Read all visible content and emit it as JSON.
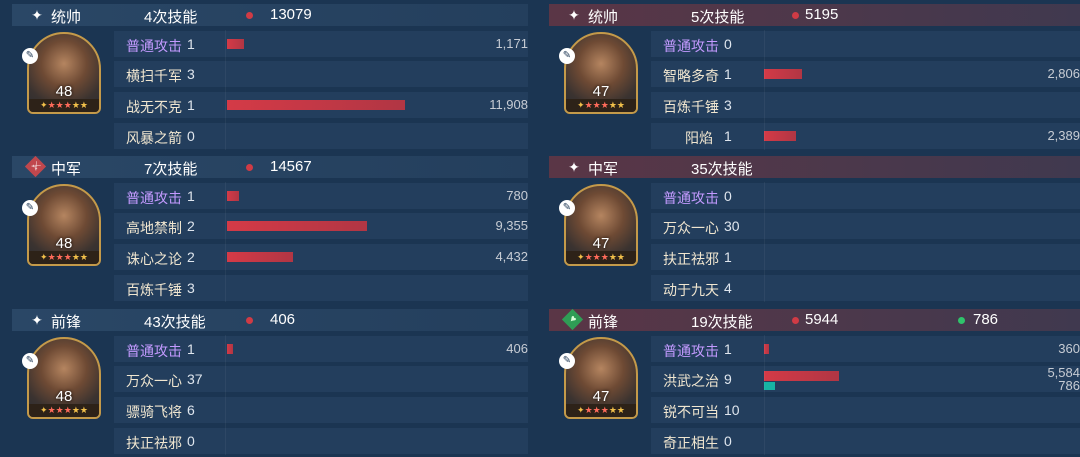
{
  "left": {
    "sections": [
      {
        "role": "统帅",
        "role_icon": "sparkle-icon",
        "skill_count": "4次技能",
        "damage": "13079",
        "level": "48",
        "rows": [
          {
            "name": "普通攻击",
            "count": "1",
            "value": "1,171",
            "bar_fraction": 0.0983,
            "normal": true
          },
          {
            "name": "横扫千军",
            "count": "3",
            "value": "",
            "bar_fraction": 0,
            "normal": false
          },
          {
            "name": "战无不克",
            "count": "1",
            "value": "11,908",
            "bar_fraction": 1.0,
            "normal": false
          },
          {
            "name": "风暴之箭",
            "count": "0",
            "value": "",
            "bar_fraction": 0,
            "normal": false
          }
        ]
      },
      {
        "role": "中军",
        "role_icon": "sword-icon",
        "skill_count": "7次技能",
        "damage": "14567",
        "level": "48",
        "rows": [
          {
            "name": "普通攻击",
            "count": "1",
            "value": "780",
            "bar_fraction": 0.0655,
            "normal": true
          },
          {
            "name": "高地禁制",
            "count": "2",
            "value": "9,355",
            "bar_fraction": 0.7856,
            "normal": false
          },
          {
            "name": "诛心之论",
            "count": "2",
            "value": "4,432",
            "bar_fraction": 0.3722,
            "normal": false
          },
          {
            "name": "百炼千锤",
            "count": "3",
            "value": "",
            "bar_fraction": 0,
            "normal": false
          }
        ]
      },
      {
        "role": "前锋",
        "role_icon": "sparkle-icon",
        "skill_count": "43次技能",
        "damage": "406",
        "level": "48",
        "rows": [
          {
            "name": "普通攻击",
            "count": "1",
            "value": "406",
            "bar_fraction": 0.0341,
            "normal": true
          },
          {
            "name": "万众一心",
            "count": "37",
            "value": "",
            "bar_fraction": 0,
            "normal": false
          },
          {
            "name": "骠骑飞将",
            "count": "6",
            "value": "",
            "bar_fraction": 0,
            "normal": false
          },
          {
            "name": "扶正祛邪",
            "count": "0",
            "value": "",
            "bar_fraction": 0,
            "normal": false
          }
        ]
      }
    ]
  },
  "right": {
    "sections": [
      {
        "role": "统帅",
        "role_icon": "sparkle-icon",
        "skill_count": "5次技能",
        "damage": "5195",
        "heal": "",
        "level": "47",
        "rows": [
          {
            "name": "普通攻击",
            "count": "0",
            "value": "",
            "bar_fraction": 0,
            "normal": true
          },
          {
            "name": "智略多奇",
            "count": "1",
            "value": "2,806",
            "bar_fraction": 0.2356,
            "normal": false
          },
          {
            "name": "百炼千锤",
            "count": "3",
            "value": "",
            "bar_fraction": 0,
            "normal": false
          },
          {
            "name": "阳焰",
            "count": "1",
            "value": "2,389",
            "bar_fraction": 0.2006,
            "normal": false
          }
        ]
      },
      {
        "role": "中军",
        "role_icon": "sparkle-icon",
        "skill_count": "35次技能",
        "damage": "",
        "heal": "",
        "level": "47",
        "rows": [
          {
            "name": "普通攻击",
            "count": "0",
            "value": "",
            "bar_fraction": 0,
            "normal": true
          },
          {
            "name": "万众一心",
            "count": "30",
            "value": "",
            "bar_fraction": 0,
            "normal": false
          },
          {
            "name": "扶正祛邪",
            "count": "1",
            "value": "",
            "bar_fraction": 0,
            "normal": false
          },
          {
            "name": "动于九天",
            "count": "4",
            "value": "",
            "bar_fraction": 0,
            "normal": false
          }
        ]
      },
      {
        "role": "前锋",
        "role_icon": "heart-icon",
        "skill_count": "19次技能",
        "damage": "5944",
        "heal": "786",
        "level": "47",
        "rows": [
          {
            "name": "普通攻击",
            "count": "1",
            "value": "360",
            "bar_fraction": 0.0302,
            "normal": true
          },
          {
            "name": "洪武之治",
            "count": "9",
            "value": "5,584",
            "value2": "786",
            "bar_fraction": 0.4689,
            "bar2_fraction": 0.066,
            "normal": false
          },
          {
            "name": "锐不可当",
            "count": "10",
            "value": "",
            "bar_fraction": 0,
            "normal": false
          },
          {
            "name": "奇正相生",
            "count": "0",
            "value": "",
            "bar_fraction": 0,
            "normal": false
          }
        ]
      }
    ]
  },
  "colors": {
    "background": "#1b3552",
    "damage_dot": "#d03b45",
    "heal_dot": "#2fc36b",
    "bar_damage": "#d43a47",
    "bar_heal": "#16b4a4",
    "normal_attack": "#c39aff",
    "skill_name": "#f0e6d0",
    "star": "#f2c04a"
  }
}
